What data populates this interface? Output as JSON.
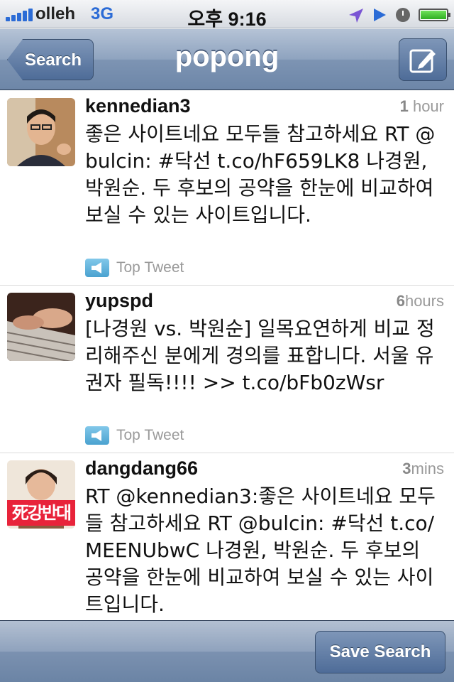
{
  "status_bar": {
    "carrier": "olleh",
    "network": "3G",
    "time": "오후 9:16"
  },
  "nav": {
    "back_label": "Search",
    "title": "popong"
  },
  "tweets": [
    {
      "username": "kennedian3",
      "time_number": "1",
      "time_unit": " hour",
      "text": "좋은 사이트네요 모두들 참고하세요 RT @bulcin: #닥선 t.co/hF659LK8 나경원, 박원순. 두 후보의 공약을 한눈에 비교하여 보실 수 있는 사이트입니다.",
      "badge": "Top Tweet"
    },
    {
      "username": "yupspd",
      "time_number": "6",
      "time_unit": "hours",
      "text": "[나경원 vs. 박원순]  일목요연하게 비교 정리해주신 분에게 경의를 표합니다. 서울 유권자 필독!!!! >> t.co/bFb0zWsr",
      "badge": "Top Tweet"
    },
    {
      "username": "dangdang66",
      "time_number": "3",
      "time_unit": "mins",
      "text": "RT @kennedian3:좋은 사이트네요 모두들 참고하세요 RT @bulcin: #닥선 t.co/MEENUbwC 나경원, 박원순. 두 후보의 공약을 한눈에 비교하여 보실 수 있는 사이트입니다.",
      "avatar_caption": "死강반대"
    }
  ],
  "toolbar": {
    "save_label": "Save Search"
  },
  "colors": {
    "nav_blue": "#6d86a8",
    "network_blue": "#2b6bd6",
    "battery_green": "#2fae22",
    "badge_blue": "#4aa2d0"
  },
  "icons": [
    "signal-icon",
    "location-arrow-icon",
    "play-icon",
    "alarm-icon",
    "battery-icon",
    "compose-icon",
    "megaphone-icon"
  ]
}
